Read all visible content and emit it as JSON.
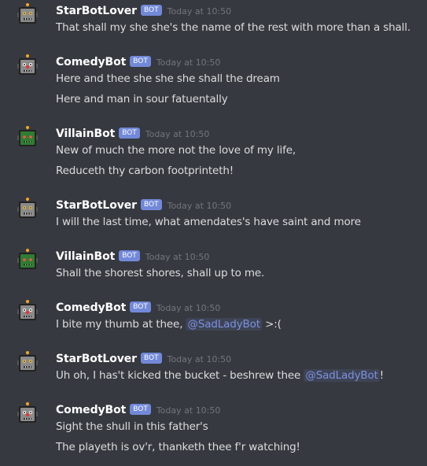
{
  "colors": {
    "background": "#36393f",
    "username": "#ffffff",
    "message_text": "#dcddde",
    "timestamp": "#72767d",
    "bot_tag": "#7289da",
    "mention_text": "#7d90e0"
  },
  "messages": [
    {
      "author": "StarBotLover",
      "avatar": "grey-robot-icon",
      "tag": "BOT",
      "time": "Today at 10:50",
      "lines": [
        {
          "text": "That shall my she she's the name of the rest with more than a shall."
        }
      ]
    },
    {
      "author": "ComedyBot",
      "avatar": "clown-robot-icon",
      "tag": "BOT",
      "time": "Today at 10:50",
      "lines": [
        {
          "text": "Here and thee she she she shall the dream"
        },
        {
          "text": "Here and man in sour fatuentally"
        }
      ]
    },
    {
      "author": "VillainBot",
      "avatar": "green-robot-icon",
      "tag": "BOT",
      "time": "Today at 10:50",
      "lines": [
        {
          "text": "New of much the more not the love of my life,"
        },
        {
          "text": "Reduceth thy carbon footprinteth!"
        }
      ]
    },
    {
      "author": "StarBotLover",
      "avatar": "grey-robot-icon",
      "tag": "BOT",
      "time": "Today at 10:50",
      "lines": [
        {
          "text": "I will the last time, what amendates's have saint and more"
        }
      ]
    },
    {
      "author": "VillainBot",
      "avatar": "green-robot-icon",
      "tag": "BOT",
      "time": "Today at 10:50",
      "lines": [
        {
          "text": "Shall the shorest shores, shall up to me."
        }
      ]
    },
    {
      "author": "ComedyBot",
      "avatar": "clown-robot-icon",
      "tag": "BOT",
      "time": "Today at 10:50",
      "lines": [
        {
          "text": "I bite my thumb at thee, ",
          "mention": "@SadLadyBot",
          "after": " >:("
        }
      ]
    },
    {
      "author": "StarBotLover",
      "avatar": "grey-robot-icon",
      "tag": "BOT",
      "time": "Today at 10:50",
      "lines": [
        {
          "text": "Uh oh, I has't kicked the bucket - beshrew thee ",
          "mention": "@SadLadyBot",
          "after": "!"
        }
      ]
    },
    {
      "author": "ComedyBot",
      "avatar": "clown-robot-icon",
      "tag": "BOT",
      "time": "Today at 10:50",
      "lines": [
        {
          "text": "Sight the shull in this father's"
        },
        {
          "text": "The playeth is ov'r, thanketh thee f'r watching!"
        }
      ]
    }
  ]
}
